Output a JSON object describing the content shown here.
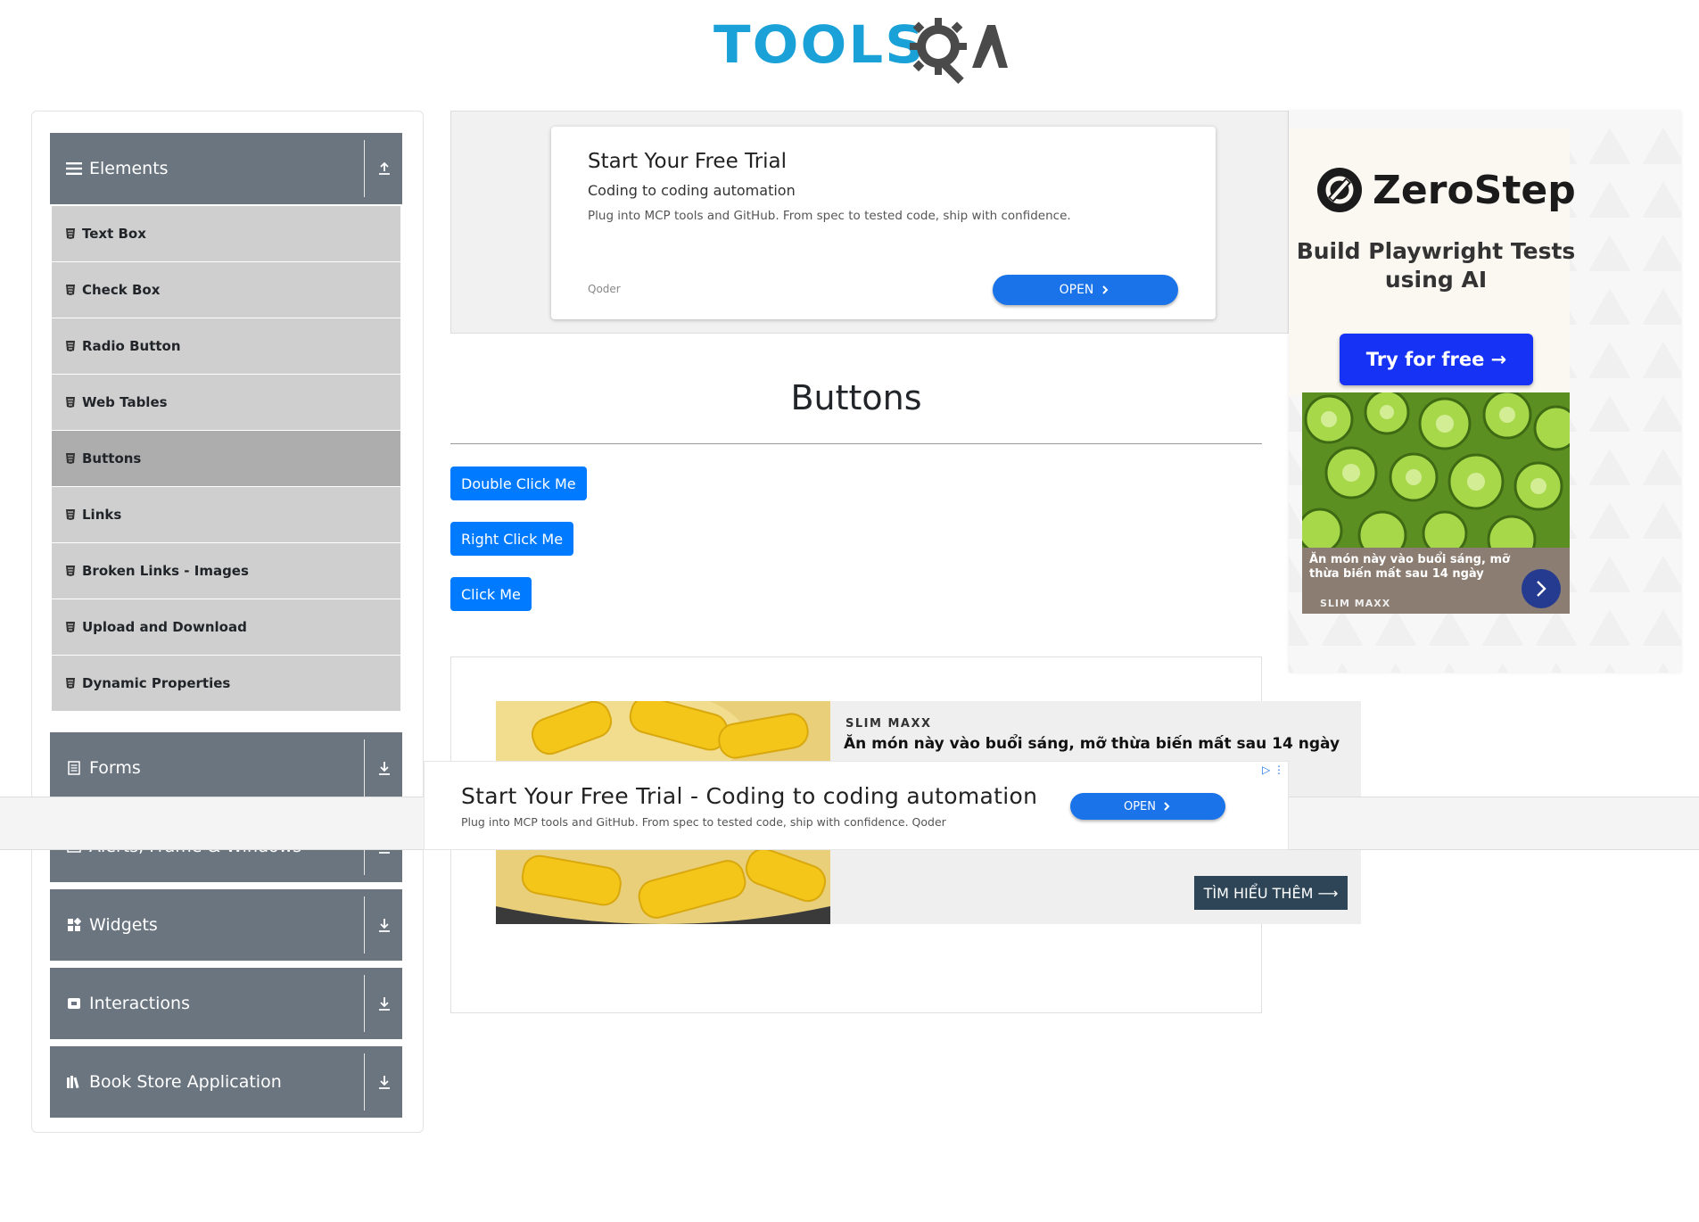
{
  "logo": {
    "text": "TOOLS",
    "qa": "QA"
  },
  "sidebar": {
    "groups": [
      {
        "label": "Elements",
        "icon": "hamburger-icon",
        "arrow": "upload-arrow-icon"
      },
      {
        "label": "Forms",
        "icon": "form-icon",
        "arrow": "download-arrow-icon"
      },
      {
        "label": "Alerts, Frame & Windows",
        "icon": "window-icon",
        "arrow": "download-arrow-icon"
      },
      {
        "label": "Widgets",
        "icon": "widgets-icon",
        "arrow": "download-arrow-icon"
      },
      {
        "label": "Interactions",
        "icon": "interactions-icon",
        "arrow": "download-arrow-icon"
      },
      {
        "label": "Book Store Application",
        "icon": "books-icon",
        "arrow": "download-arrow-icon"
      }
    ],
    "items": [
      {
        "label": "Text Box"
      },
      {
        "label": "Check Box"
      },
      {
        "label": "Radio Button"
      },
      {
        "label": "Web Tables"
      },
      {
        "label": "Buttons",
        "active": true
      },
      {
        "label": "Links"
      },
      {
        "label": "Broken Links - Images"
      },
      {
        "label": "Upload and Download"
      },
      {
        "label": "Dynamic Properties"
      }
    ]
  },
  "ad_top": {
    "title": "Start Your Free Trial",
    "subtitle": "Coding to coding automation",
    "description": "Plug into MCP tools and GitHub. From spec to tested code, ship with confidence.",
    "brand": "Qoder",
    "button": "OPEN"
  },
  "ad_right": {
    "brand": "ZeroStep",
    "tagline": "Build Playwright Tests using AI",
    "button": "Try for free →",
    "caption": "Ăn món này vào buổi sáng, mỡ thừa biến mất sau 14 ngày",
    "caption_brand": "SLIM MAXX"
  },
  "main": {
    "title": "Buttons",
    "buttons": [
      "Double Click Me",
      "Right Click Me",
      "Click Me"
    ]
  },
  "ad_corn": {
    "brand": "SLIM MAXX",
    "text": "Ăn món này vào buổi sáng, mỡ thừa biến mất sau 14 ngày",
    "button": "TÌM HIỂU THÊM ⟶"
  },
  "ad_sticky": {
    "title": "Start Your Free Trial - Coding to coding automation",
    "description": "Plug into MCP tools and GitHub. From spec to tested code, ship with confidence. Qoder",
    "button": "OPEN"
  },
  "colors": {
    "sidebar_header": "#6b7580",
    "menu_item": "#cfcfcf",
    "menu_item_active": "#adadad",
    "primary_button": "#007bff",
    "logo_blue": "#1aa1d7",
    "ad_open": "#1a73e8",
    "zerostep_button": "#1532f5"
  }
}
